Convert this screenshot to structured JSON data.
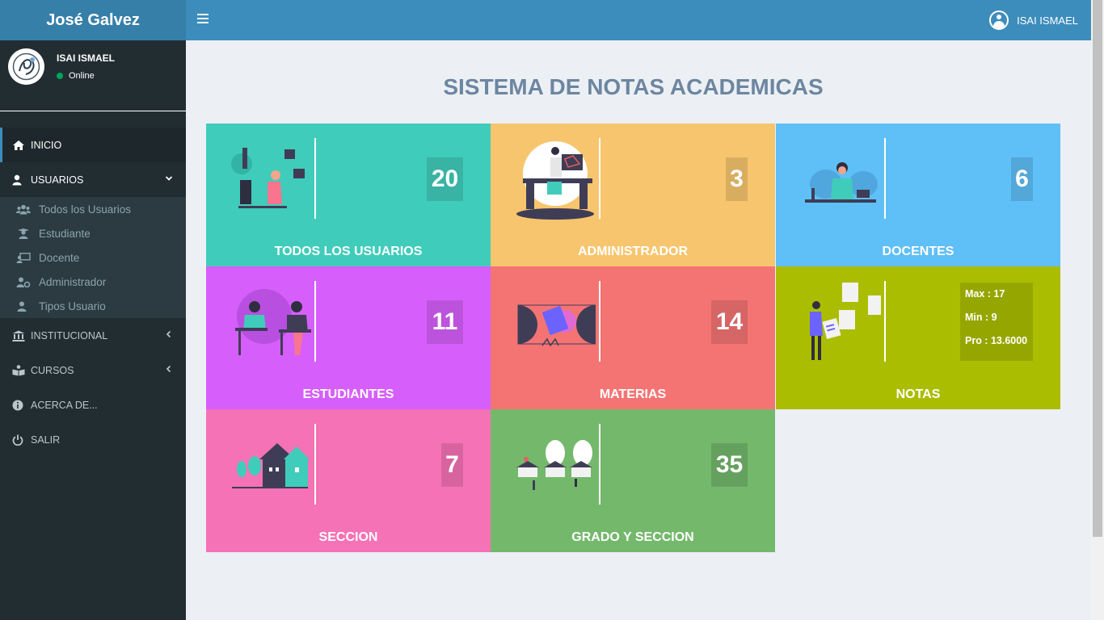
{
  "app": {
    "brand": "José Galvez"
  },
  "header": {
    "user_name": "ISAI ISMAEL"
  },
  "sidebar": {
    "user_name": "ISAI ISMAEL",
    "status": "Online",
    "menu": [
      {
        "label": "INICIO",
        "icon": "home-icon"
      },
      {
        "label": "USUARIOS",
        "icon": "user-icon"
      },
      {
        "label": "INSTITUCIONAL",
        "icon": "bank-icon"
      },
      {
        "label": "CURSOS",
        "icon": "book-reader-icon"
      },
      {
        "label": "ACERCA DE...",
        "icon": "info-icon"
      },
      {
        "label": "SALIR",
        "icon": "power-icon"
      }
    ],
    "submenu": [
      {
        "label": "Todos los Usuarios",
        "icon": "users-icon"
      },
      {
        "label": "Estudiante",
        "icon": "graduate-icon"
      },
      {
        "label": "Docente",
        "icon": "chalkboard-teacher-icon"
      },
      {
        "label": "Administrador",
        "icon": "user-cog-icon"
      },
      {
        "label": "Tipos Usuario",
        "icon": "user-tag-icon"
      }
    ]
  },
  "main": {
    "title": "SISTEMA DE NOTAS ACADEMICAS",
    "cards": [
      {
        "label": "TODOS LOS USUARIOS",
        "value": "20",
        "color": "#40ccbb"
      },
      {
        "label": "ADMINISTRADOR",
        "value": "3",
        "color": "#f7c56e"
      },
      {
        "label": "DOCENTES",
        "value": "6",
        "color": "#5fbff7"
      },
      {
        "label": "ESTUDIANTES",
        "value": "11",
        "color": "#d65ffb"
      },
      {
        "label": "MATERIAS",
        "value": "14",
        "color": "#f47474"
      },
      {
        "label": "NOTAS",
        "max": "Max : 17",
        "min": "Min : 9",
        "pro": "Pro : 13.6000",
        "color": "#abbd00"
      },
      {
        "label": "SECCION",
        "value": "7",
        "color": "#f572b6"
      },
      {
        "label": "GRADO Y SECCION",
        "value": "35",
        "color": "#74b86c"
      }
    ]
  }
}
